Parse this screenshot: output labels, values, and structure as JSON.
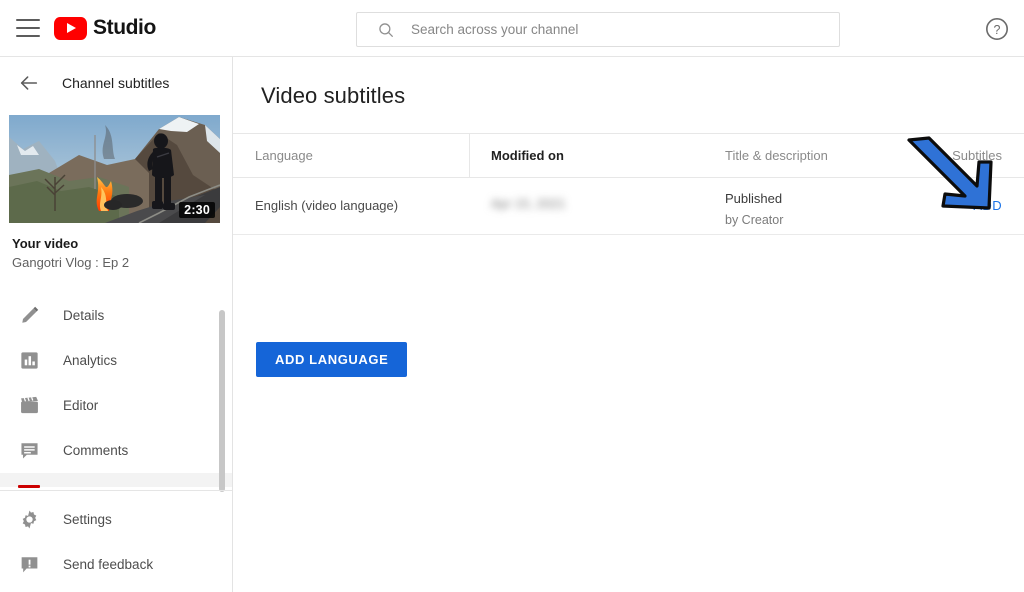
{
  "topbar": {
    "menu_icon": "hamburger-icon",
    "brand": "Studio",
    "logo_icon": "youtube-logo-icon",
    "help_icon": "help-circle-icon",
    "search": {
      "placeholder": "Search across your channel",
      "value": "",
      "icon": "search-icon"
    }
  },
  "sidebar": {
    "back_icon": "back-arrow-icon",
    "header_title": "Channel subtitles",
    "video": {
      "duration": "2:30",
      "label": "Your video",
      "title": "Gangotri Vlog : Ep 2"
    },
    "items": [
      {
        "label": "Details",
        "icon": "pencil-icon",
        "active": false
      },
      {
        "label": "Analytics",
        "icon": "bar-chart-icon",
        "active": false
      },
      {
        "label": "Editor",
        "icon": "clapperboard-icon",
        "active": false
      },
      {
        "label": "Comments",
        "icon": "comment-icon",
        "active": false
      },
      {
        "label": "",
        "icon": "subtitles-icon",
        "active": true
      }
    ],
    "bottom_items": [
      {
        "label": "Settings",
        "icon": "gear-icon"
      },
      {
        "label": "Send feedback",
        "icon": "feedback-icon"
      }
    ]
  },
  "main": {
    "page_title": "Video subtitles",
    "table": {
      "columns": [
        {
          "key": "language",
          "label": "Language",
          "sorted": false
        },
        {
          "key": "modified",
          "label": "Modified on",
          "sorted": true
        },
        {
          "key": "title",
          "label": "Title & description",
          "sorted": false
        },
        {
          "key": "subtitles",
          "label": "Subtitles",
          "sorted": false
        }
      ],
      "rows": [
        {
          "language": "English (video language)",
          "modified": "Apr 15, 2021",
          "status_primary": "Published",
          "status_secondary": "by Creator",
          "action": "ADD"
        }
      ]
    },
    "add_language_button": "ADD LANGUAGE"
  },
  "annotation": {
    "arrow_icon": "down-right-arrow-icon",
    "arrow_fill": "#2f72d6",
    "arrow_stroke": "#0c0c0c"
  },
  "colors": {
    "accent_blue": "#1565d8",
    "link_blue": "#1a73e8",
    "youtube_red": "#ff0000",
    "active_red": "#cc0000"
  }
}
